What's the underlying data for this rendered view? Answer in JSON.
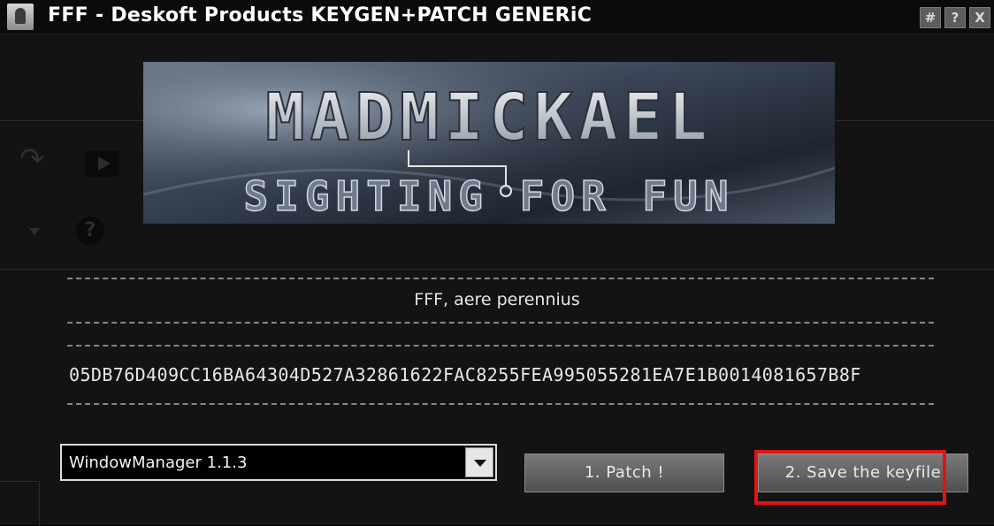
{
  "window": {
    "title": "FFF - Deskoft Products KEYGEN+PATCH GENERiC",
    "controls": [
      "#",
      "?",
      "X"
    ]
  },
  "banner": {
    "logo_icon": "madmickael-logo",
    "line1": "MADMICKAEL",
    "line2": "SIGHTING FOR FUN"
  },
  "info_text": "FFF, aere perennius",
  "serial": "05DB76D409CC16BA64304D527A32861622FAC8255FEA995055281EA7E1B0014081657B8F",
  "product_select": {
    "value": "WindowManager 1.1.3"
  },
  "buttons": {
    "patch": "1. Patch !",
    "save_keyfile": "2. Save the keyfile"
  },
  "highlight": {
    "color": "#e01414",
    "target": "save-keyfile-button"
  },
  "colors": {
    "background": "#131313",
    "titlebar": "#0b0b0b",
    "text": "#e6e6e6"
  }
}
